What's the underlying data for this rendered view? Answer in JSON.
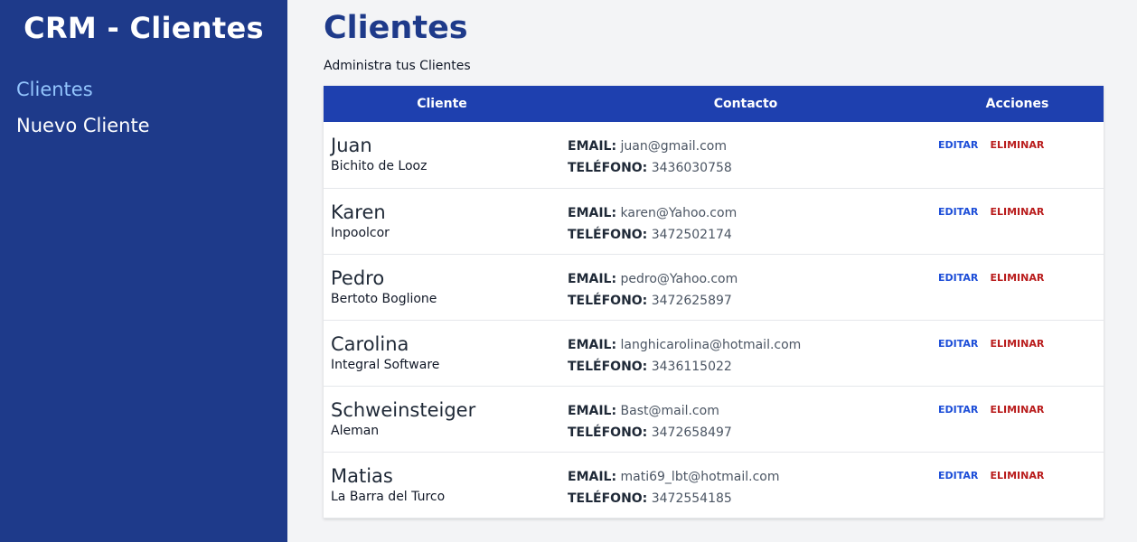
{
  "sidebar": {
    "brand": "CRM - Clientes",
    "nav": [
      {
        "label": "Clientes",
        "active": true
      },
      {
        "label": "Nuevo Cliente",
        "active": false
      }
    ]
  },
  "main": {
    "title": "Clientes",
    "subtitle": "Administra tus Clientes"
  },
  "table": {
    "headers": [
      "Cliente",
      "Contacto",
      "Acciones"
    ],
    "email_label": "EMAIL:",
    "phone_label": "TELÉFONO:",
    "edit_label": "EDITAR",
    "delete_label": "ELIMINAR",
    "rows": [
      {
        "name": "Juan",
        "company": "Bichito de Looz",
        "email": "juan@gmail.com",
        "phone": "3436030758"
      },
      {
        "name": "Karen",
        "company": "Inpoolcor",
        "email": "karen@Yahoo.com",
        "phone": "3472502174"
      },
      {
        "name": "Pedro",
        "company": "Bertoto Boglione",
        "email": "pedro@Yahoo.com",
        "phone": "3472625897"
      },
      {
        "name": "Carolina",
        "company": "Integral Software",
        "email": "langhicarolina@hotmail.com",
        "phone": "3436115022"
      },
      {
        "name": "Schweinsteiger",
        "company": "Aleman",
        "email": "Bast@mail.com",
        "phone": "3472658497"
      },
      {
        "name": "Matias",
        "company": "La Barra del Turco",
        "email": "mati69_lbt@hotmail.com",
        "phone": "3472554185"
      }
    ]
  },
  "colors": {
    "sidebar_bg": "#1e3a8a",
    "header_bg": "#1e40af",
    "active_nav": "#93c5fd",
    "edit": "#1d4ed8",
    "delete": "#b91c1c"
  }
}
